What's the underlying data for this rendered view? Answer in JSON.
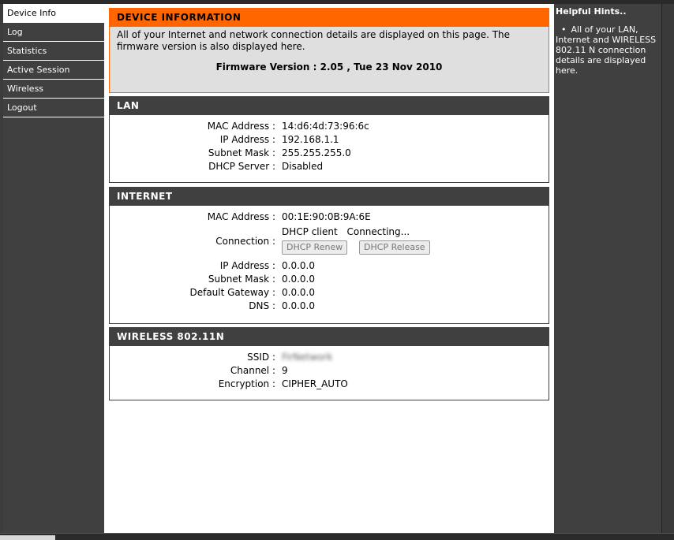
{
  "sidebar": {
    "items": [
      {
        "label": "Device Info"
      },
      {
        "label": "Log"
      },
      {
        "label": "Statistics"
      },
      {
        "label": "Active Session"
      },
      {
        "label": "Wireless"
      },
      {
        "label": "Logout"
      }
    ]
  },
  "device_info": {
    "title": "DEVICE INFORMATION",
    "description": "All of your Internet and network connection details are displayed on this page. The firmware version is also displayed here.",
    "firmware": "Firmware Version : 2.05 ,  Tue 23 Nov 2010"
  },
  "lan": {
    "title": "LAN",
    "mac_label": "MAC Address :",
    "mac_value": "14:d6:4d:73:96:6c",
    "ip_label": "IP Address :",
    "ip_value": "192.168.1.1",
    "subnet_label": "Subnet Mask :",
    "subnet_value": "255.255.255.0",
    "dhcp_label": "DHCP Server :",
    "dhcp_value": "Disabled"
  },
  "internet": {
    "title": "INTERNET",
    "mac_label": "MAC Address :",
    "mac_value": "00:1E:90:0B:9A:6E",
    "connection_label": "Connection :",
    "connection_type": "DHCP client",
    "connection_status": "Connecting...",
    "renew_button": "DHCP Renew",
    "release_button": "DHCP Release",
    "ip_label": "IP Address :",
    "ip_value": "0.0.0.0",
    "subnet_label": "Subnet Mask :",
    "subnet_value": "0.0.0.0",
    "gateway_label": "Default Gateway :",
    "gateway_value": "0.0.0.0",
    "dns_label": "DNS :",
    "dns_value": "0.0.0.0"
  },
  "wireless": {
    "title": "WIRELESS 802.11N",
    "ssid_label": "SSID :",
    "ssid_value": "FirNetwork",
    "channel_label": "Channel :",
    "channel_value": "9",
    "encryption_label": "Encryption :",
    "encryption_value": "CIPHER_AUTO"
  },
  "hints": {
    "title": "Helpful Hints..",
    "bullet": "•",
    "text": "All of your LAN, Internet and WIRELESS 802.11 N connection details are displayed here."
  }
}
